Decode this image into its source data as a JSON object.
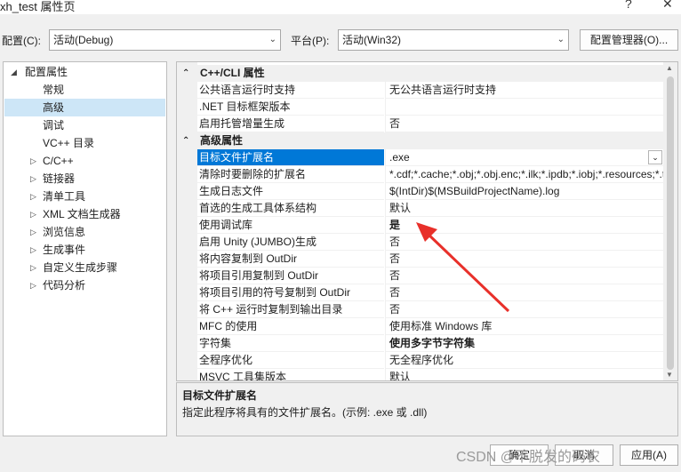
{
  "window": {
    "title": "xh_test 属性页",
    "help_label": "?",
    "close_label": "✕"
  },
  "config": {
    "config_label": "配置(C):",
    "config_value": "活动(Debug)",
    "platform_label": "平台(P):",
    "platform_value": "活动(Win32)",
    "manager_button": "配置管理器(O)..."
  },
  "tree": {
    "root": "配置属性",
    "items": [
      {
        "label": "常规",
        "expandable": false,
        "selected": false
      },
      {
        "label": "高级",
        "expandable": false,
        "selected": true
      },
      {
        "label": "调试",
        "expandable": false,
        "selected": false
      },
      {
        "label": "VC++ 目录",
        "expandable": false,
        "selected": false
      },
      {
        "label": "C/C++",
        "expandable": true,
        "selected": false
      },
      {
        "label": "链接器",
        "expandable": true,
        "selected": false
      },
      {
        "label": "清单工具",
        "expandable": true,
        "selected": false
      },
      {
        "label": "XML 文档生成器",
        "expandable": true,
        "selected": false
      },
      {
        "label": "浏览信息",
        "expandable": true,
        "selected": false
      },
      {
        "label": "生成事件",
        "expandable": true,
        "selected": false
      },
      {
        "label": "自定义生成步骤",
        "expandable": true,
        "selected": false
      },
      {
        "label": "代码分析",
        "expandable": true,
        "selected": false
      }
    ]
  },
  "grid": {
    "category1": "C++/CLI 属性",
    "cat1_rows": [
      {
        "name": "公共语言运行时支持",
        "value": "无公共语言运行时支持"
      },
      {
        "name": ".NET 目标框架版本",
        "value": ""
      },
      {
        "name": "启用托管增量生成",
        "value": "否"
      }
    ],
    "category2": "高级属性",
    "cat2_rows": [
      {
        "name": "目标文件扩展名",
        "value": ".exe"
      },
      {
        "name": "清除时要删除的扩展名",
        "value": "*.cdf;*.cache;*.obj;*.obj.enc;*.ilk;*.ipdb;*.iobj;*.resources;*.tlb;*.tli;*.tlh;*.tmp;*.rsp"
      },
      {
        "name": "生成日志文件",
        "value": "$(IntDir)$(MSBuildProjectName).log"
      },
      {
        "name": "首选的生成工具体系结构",
        "value": "默认"
      },
      {
        "name": "使用调试库",
        "value": "是"
      },
      {
        "name": "启用 Unity (JUMBO)生成",
        "value": "否"
      },
      {
        "name": "将内容复制到 OutDir",
        "value": "否"
      },
      {
        "name": "将项目引用复制到 OutDir",
        "value": "否"
      },
      {
        "name": "将项目引用的符号复制到 OutDir",
        "value": "否"
      },
      {
        "name": "将 C++ 运行时复制到输出目录",
        "value": "否"
      },
      {
        "name": "MFC 的使用",
        "value": "使用标准 Windows 库"
      },
      {
        "name": "字符集",
        "value": "使用多字节字符集"
      },
      {
        "name": "全程序优化",
        "value": "无全程序优化"
      },
      {
        "name": "MSVC 工具集版本",
        "value": "默认"
      }
    ]
  },
  "description": {
    "title": "目标文件扩展名",
    "text": "指定此程序将具有的文件扩展名。(示例: .exe 或 .dll)"
  },
  "buttons": {
    "ok": "确定",
    "cancel": "取消",
    "apply": "应用(A)"
  },
  "watermark": "CSDN @不脱发的码农",
  "colors": {
    "selection": "#0078d7",
    "tree_selection": "#cde6f7",
    "arrow": "#e8302a"
  }
}
